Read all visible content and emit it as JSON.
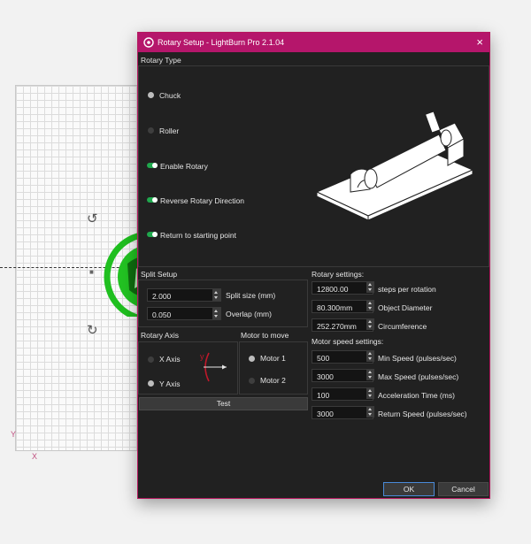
{
  "window": {
    "title": "Rotary Setup - LightBurn Pro 2.1.04",
    "close_glyph": "×",
    "accent": "#b5166b"
  },
  "canvas": {
    "y_label": "Y",
    "x_label": "X"
  },
  "rotary_type": {
    "title": "Rotary Type",
    "chuck_label": "Chuck",
    "chuck_selected": true,
    "roller_label": "Roller",
    "roller_selected": false,
    "enable_rotary_label": "Enable Rotary",
    "enable_rotary_on": true,
    "reverse_direction_label": "Reverse Rotary Direction",
    "reverse_direction_on": true,
    "return_start_label": "Return to starting point",
    "return_start_on": true
  },
  "split_setup": {
    "title": "Split Setup",
    "split_size_value": "2.000",
    "split_size_label": "Split size (mm)",
    "overlap_value": "0.050",
    "overlap_label": "Overlap (mm)"
  },
  "rotary_axis": {
    "title": "Rotary Axis",
    "x_axis_label": "X Axis",
    "x_axis_selected": false,
    "y_axis_label": "Y Axis",
    "y_axis_selected": true,
    "diagram_label": "y"
  },
  "motor_to_move": {
    "title": "Motor to move",
    "motor1_label": "Motor 1",
    "motor1_selected": true,
    "motor2_label": "Motor 2",
    "motor2_selected": false
  },
  "test_button": "Test",
  "rotary_settings": {
    "title": "Rotary settings:",
    "steps_value": "12800.00",
    "steps_label": "steps per rotation",
    "diameter_value": "80.300mm",
    "diameter_label": "Object Diameter",
    "circumference_value": "252.270mm",
    "circumference_label": "Circumference"
  },
  "motor_speed": {
    "title": "Motor speed settings:",
    "min_value": "500",
    "min_label": "Min Speed (pulses/sec)",
    "max_value": "3000",
    "max_label": "Max Speed (pulses/sec)",
    "accel_value": "100",
    "accel_label": "Acceleration Time (ms)",
    "return_value": "3000",
    "return_label": "Return Speed (pulses/sec)"
  },
  "footer": {
    "ok": "OK",
    "cancel": "Cancel"
  },
  "icons": [
    "lightburn-logo-icon",
    "close-icon",
    "rotate-handle-icon",
    "rotary-chuck-illustration",
    "spin-arrows-icon"
  ]
}
